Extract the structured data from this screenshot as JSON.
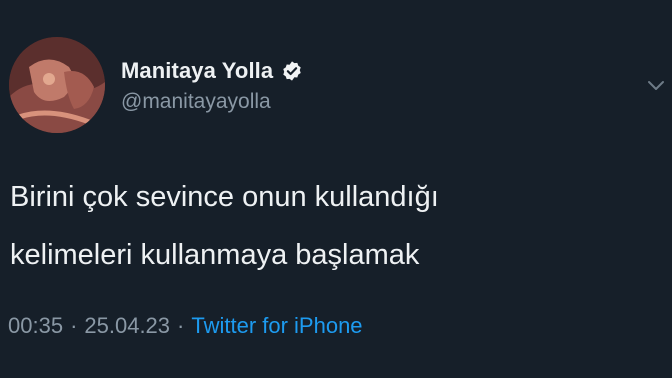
{
  "tweet": {
    "display_name": "Manitaya Yolla",
    "handle": "@manitayayolla",
    "text_lines": [
      "Birini çok sevince onun kullandığı",
      "kelimeleri kullanmaya başlamak"
    ],
    "time": "00:35",
    "separator": "·",
    "date": "25.04.23",
    "source": "Twitter for iPhone",
    "verified": true
  },
  "icons": {
    "verified": "verified-badge-icon",
    "chevron": "chevron-down-icon"
  },
  "colors": {
    "background": "#161f29",
    "primary_text": "#eef1f3",
    "secondary_text": "#8a98a5",
    "link": "#1d9bf0"
  }
}
